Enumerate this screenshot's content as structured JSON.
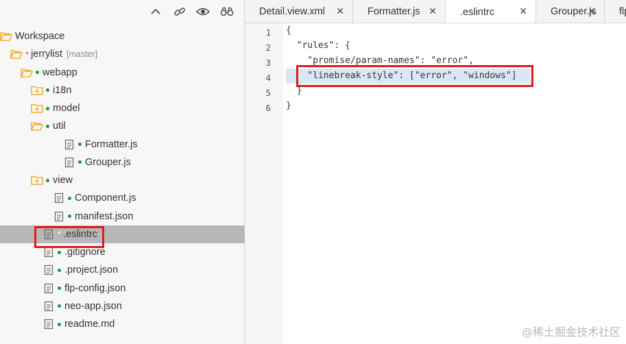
{
  "toolbar": {
    "icons": [
      "collapse-all-icon",
      "link-editor-icon",
      "show-hidden-icon",
      "binoculars-icon"
    ]
  },
  "tree": [
    {
      "label": "Workspace",
      "icon": "folder-open",
      "indent": 0
    },
    {
      "label": "jerrylist",
      "icon": "folder-open",
      "indent": 1,
      "star": "*",
      "branch": "[master]"
    },
    {
      "label": "webapp",
      "icon": "folder-open",
      "indent": 2,
      "dot": true
    },
    {
      "label": "i18n",
      "icon": "folder-closed",
      "indent": 3,
      "dot": true
    },
    {
      "label": "model",
      "icon": "folder-closed",
      "indent": 3,
      "dot": true
    },
    {
      "label": "util",
      "icon": "folder-open",
      "indent": 3,
      "dot": true
    },
    {
      "label": "Formatter.js",
      "icon": "file",
      "indent": 4,
      "dot": true
    },
    {
      "label": "Grouper.js",
      "icon": "file",
      "indent": 4,
      "dot": true
    },
    {
      "label": "view",
      "icon": "folder-closed",
      "indent": 3,
      "dot": true
    },
    {
      "label": "Component.js",
      "icon": "file",
      "indent": 3,
      "dot": true
    },
    {
      "label": "manifest.json",
      "icon": "file",
      "indent": 3,
      "dot": true
    },
    {
      "label": ".eslintrc",
      "icon": "file",
      "indent": 2,
      "star": "*",
      "selected": true
    },
    {
      "label": ".gitignore",
      "icon": "file",
      "indent": 2,
      "dot": true
    },
    {
      "label": ".project.json",
      "icon": "file",
      "indent": 2,
      "dot": true
    },
    {
      "label": "flp-config.json",
      "icon": "file",
      "indent": 2,
      "dot": true
    },
    {
      "label": "neo-app.json",
      "icon": "file",
      "indent": 2,
      "dot": true
    },
    {
      "label": "readme.md",
      "icon": "file",
      "indent": 2,
      "dot": true
    }
  ],
  "tabs": [
    {
      "label": "Detail.view.xml",
      "close": "✕"
    },
    {
      "label": "Formatter.js",
      "close": "✕"
    },
    {
      "label": ".eslintrc",
      "close": "✕",
      "active": true
    },
    {
      "label": "Grouper.js",
      "close": "✕"
    },
    {
      "label": "flp",
      "close": ""
    }
  ],
  "editor": {
    "line_numbers": [
      "1",
      "2",
      "3",
      "4",
      "5",
      "6"
    ],
    "lines": [
      "{",
      "  \"rules\": {",
      "    \"promise/param-names\": \"error\",",
      "    \"linebreak-style\": [\"error\", \"windows\"]",
      "  }",
      "}"
    ]
  },
  "colors": {
    "folder": "#f0a30a",
    "status_dot": "#1a9a3a",
    "highlight": "#e0191b",
    "line_highlight": "#d8e8f4"
  },
  "watermark": "@稀土掘金技术社区"
}
